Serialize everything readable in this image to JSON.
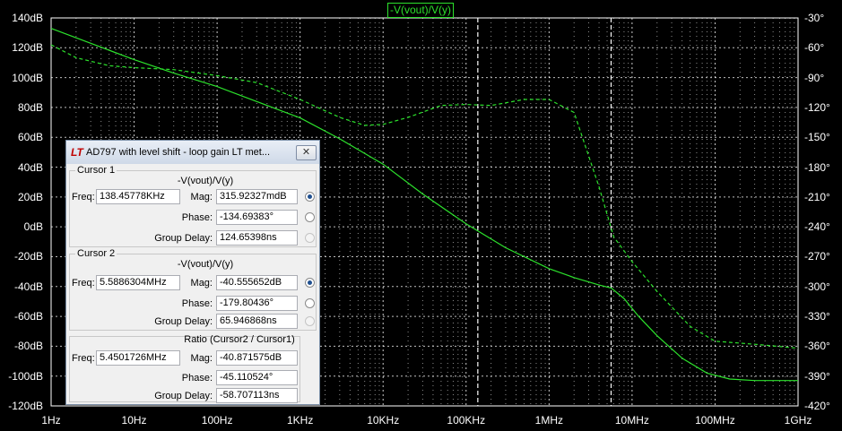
{
  "plot": {
    "trace_title": "-V(vout)/V(y)",
    "trace_color": "#2ce22c",
    "background": "#000000",
    "grid_color": "#ffffff",
    "left_axis_labels": [
      "140dB",
      "120dB",
      "100dB",
      "80dB",
      "60dB",
      "40dB",
      "20dB",
      "0dB",
      "-20dB",
      "-40dB",
      "-60dB",
      "-80dB",
      "-100dB",
      "-120dB"
    ],
    "right_axis_labels": [
      "-30°",
      "-60°",
      "-90°",
      "-120°",
      "-150°",
      "-180°",
      "-210°",
      "-240°",
      "-270°",
      "-300°",
      "-330°",
      "-360°",
      "-390°",
      "-420°"
    ],
    "x_axis_labels": [
      "1Hz",
      "10Hz",
      "100Hz",
      "1KHz",
      "10KHz",
      "100KHz",
      "1MHz",
      "10MHz",
      "100MHz",
      "1GHz"
    ]
  },
  "chart_data": {
    "type": "line",
    "x_scale": "log",
    "xlim": [
      1,
      1000000000
    ],
    "ylim": [
      -120,
      140
    ],
    "y2lim": [
      -420,
      -30
    ],
    "series": [
      {
        "name": "-V(vout)/V(y)",
        "style": "solid",
        "axis": "left",
        "x": [
          1,
          3,
          10,
          30,
          100,
          300,
          1000,
          3000,
          10000,
          30000,
          100000,
          300000,
          1000000,
          2000000,
          4000000,
          5600000,
          8000000,
          12000000,
          20000000,
          40000000,
          80000000,
          150000000,
          300000000,
          1000000000
        ],
        "y": [
          133,
          123,
          112,
          103,
          94,
          84,
          73,
          59,
          42,
          22,
          2,
          -14,
          -28,
          -34,
          -39,
          -41,
          -48,
          -60,
          -73,
          -88,
          -98,
          -102,
          -103,
          -103
        ]
      },
      {
        "name": "-V(vout)/V(y) phase",
        "style": "dashed",
        "axis": "right",
        "x": [
          1,
          2,
          5,
          10,
          30,
          100,
          300,
          1000,
          3000,
          6000,
          10000,
          20000,
          50000,
          100000,
          200000,
          500000,
          1000000,
          2000000,
          4000000,
          6000000,
          10000000,
          20000000,
          50000000,
          100000000,
          300000000,
          1000000000
        ],
        "y": [
          -57,
          -70,
          -78,
          -80,
          -82,
          -88,
          -95,
          -112,
          -130,
          -138,
          -137,
          -130,
          -118,
          -117,
          -118,
          -112,
          -112,
          -125,
          -200,
          -250,
          -275,
          -305,
          -340,
          -355,
          -358,
          -362
        ]
      }
    ]
  },
  "dialog": {
    "title": "AD797 with level shift - loop gain LT met...",
    "logo": "LT",
    "close_glyph": "✕",
    "cursor1": {
      "group_label": "Cursor 1",
      "signal": "-V(vout)/V(y)",
      "freq_label": "Freq:",
      "freq": "138.45778KHz",
      "mag_label": "Mag:",
      "mag": "315.92327mdB",
      "phase_label": "Phase:",
      "phase": "-134.69383°",
      "gd_label": "Group Delay:",
      "gd": "124.65398ns"
    },
    "cursor2": {
      "group_label": "Cursor 2",
      "signal": "-V(vout)/V(y)",
      "freq_label": "Freq:",
      "freq": "5.5886304MHz",
      "mag_label": "Mag:",
      "mag": "-40.555652dB",
      "phase_label": "Phase:",
      "phase": "-179.80436°",
      "gd_label": "Group Delay:",
      "gd": "65.946868ns"
    },
    "ratio": {
      "group_label": "Ratio (Cursor2 / Cursor1)",
      "freq_label": "Freq:",
      "freq": "5.4501726MHz",
      "mag_label": "Mag:",
      "mag": "-40.871575dB",
      "phase_label": "Phase:",
      "phase": "-45.110524°",
      "gd_label": "Group Delay:",
      "gd": "-58.707113ns"
    }
  }
}
